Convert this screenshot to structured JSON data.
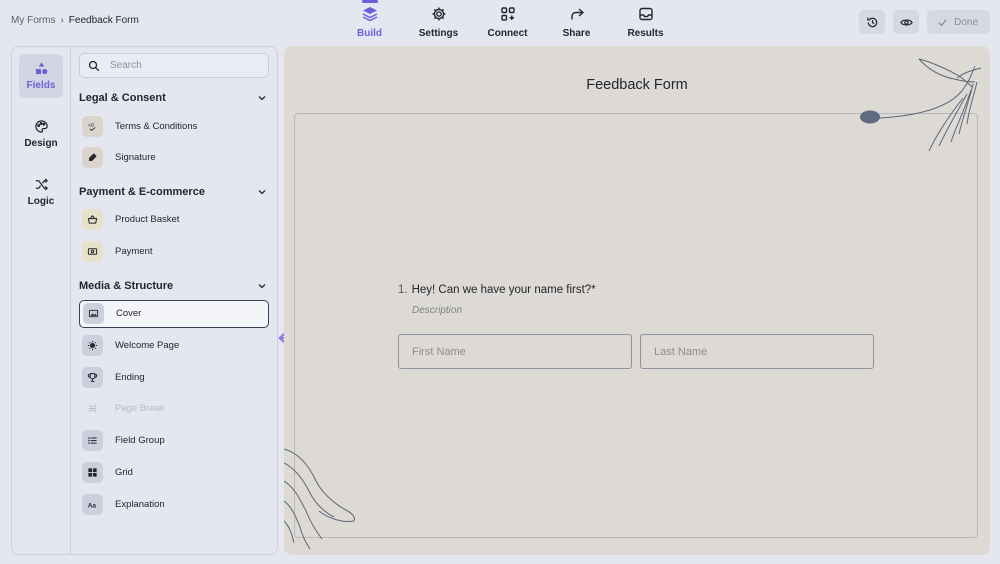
{
  "breadcrumb": {
    "parent": "My Forms",
    "separator": "›",
    "current": "Feedback Form"
  },
  "topnav": [
    {
      "label": "Build",
      "icon": "layers-icon",
      "active": true
    },
    {
      "label": "Settings",
      "icon": "gear-icon"
    },
    {
      "label": "Connect",
      "icon": "connect-icon"
    },
    {
      "label": "Share",
      "icon": "share-icon"
    },
    {
      "label": "Results",
      "icon": "inbox-icon"
    }
  ],
  "actions": {
    "done_label": "Done"
  },
  "rail": [
    {
      "label": "Fields",
      "icon": "shapes-icon",
      "active": true
    },
    {
      "label": "Design",
      "icon": "palette-icon"
    },
    {
      "label": "Logic",
      "icon": "shuffle-icon"
    }
  ],
  "search": {
    "placeholder": "Search"
  },
  "sections": [
    {
      "title": "Legal & Consent",
      "items": [
        {
          "label": "Terms & Conditions",
          "icon": "abc-check-icon"
        },
        {
          "label": "Signature",
          "icon": "pen-nib-icon"
        }
      ]
    },
    {
      "title": "Payment & E-commerce",
      "items": [
        {
          "label": "Product Basket",
          "icon": "basket-icon"
        },
        {
          "label": "Payment",
          "icon": "money-icon"
        }
      ]
    },
    {
      "title": "Media & Structure",
      "items": [
        {
          "label": "Cover",
          "icon": "image-icon",
          "selected": true
        },
        {
          "label": "Welcome Page",
          "icon": "sun-icon"
        },
        {
          "label": "Ending",
          "icon": "trophy-icon"
        },
        {
          "label": "Page Break",
          "icon": "page-break-icon",
          "disabled": true
        },
        {
          "label": "Field Group",
          "icon": "list-icon"
        },
        {
          "label": "Grid",
          "icon": "grid-icon"
        },
        {
          "label": "Explanation",
          "icon": "text-aa-icon"
        }
      ]
    }
  ],
  "form": {
    "title": "Feedback Form",
    "question_number": "1.",
    "question": "Hey! Can we have your name first?*",
    "description": "Description",
    "first_name_placeholder": "First Name",
    "last_name_placeholder": "Last Name"
  },
  "colors": {
    "accent": "#6d5fd8",
    "canvas": "#ddd9d4",
    "background": "#e4e7ef"
  }
}
